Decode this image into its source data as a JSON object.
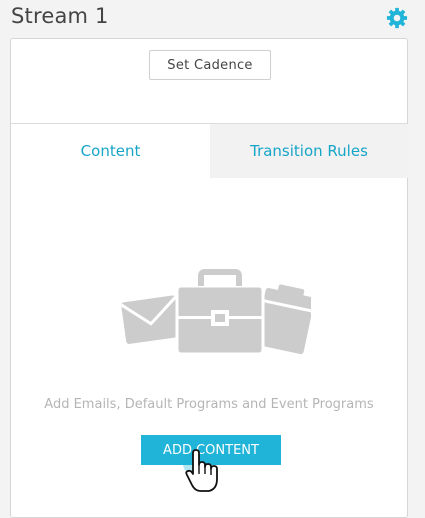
{
  "stream": {
    "title": "Stream 1",
    "settings_icon": "gear-icon"
  },
  "cadence_button": {
    "label": "Set Cadence"
  },
  "tabs": [
    {
      "label": "Content",
      "active": true
    },
    {
      "label": "Transition Rules",
      "active": false
    }
  ],
  "empty_state": {
    "illustration_icon": "email-briefcase-ticket-icon",
    "message": "Add Emails, Default Programs and Event Programs"
  },
  "add_content_button": {
    "label": "ADD CONTENT"
  },
  "cursor_icon": "hand-pointer-icon",
  "colors": {
    "accent": "#1fb4d8",
    "tab_text": "#17a5c8",
    "illustration": "#cccccc"
  }
}
